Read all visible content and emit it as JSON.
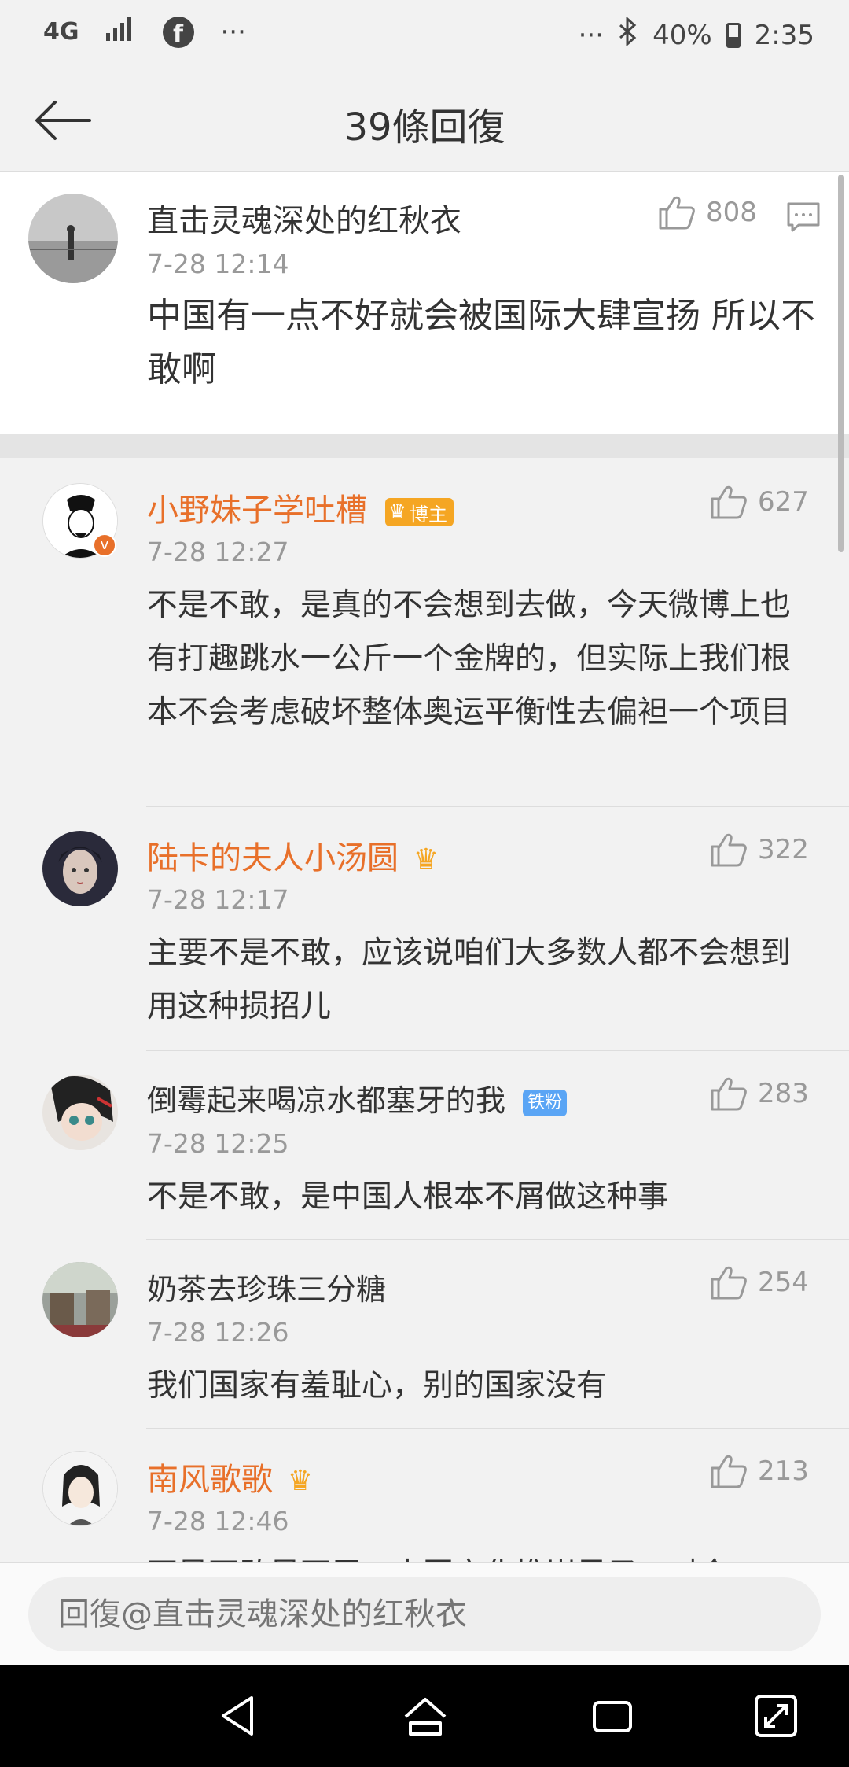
{
  "status_bar": {
    "network": "4G",
    "more": "···",
    "more_right": "···",
    "battery": "40%",
    "time": "2:35"
  },
  "header": {
    "title": "39條回復"
  },
  "post": {
    "user": "直击灵魂深处的红秋衣",
    "time": "7-28 12:14",
    "likes": "808",
    "text": "中国有一点不好就会被国际大肆宣扬 所以不敢啊"
  },
  "replies": [
    {
      "user": "小野妹子学吐槽",
      "badge": "博主",
      "time": "7-28 12:27",
      "likes": "627",
      "text": "不是不敢，是真的不会想到去做，今天微博上也有打趣跳水一公斤一个金牌的，但实际上我们根本不会考虑破坏整体奥运平衡性去偏袒一个项目"
    },
    {
      "user": "陆卡的夫人小汤圆",
      "time": "7-28 12:17",
      "likes": "322",
      "text": "主要不是不敢，应该说咱们大多数人都不会想到用这种损招儿"
    },
    {
      "user": "倒霉起来喝凉水都塞牙的我",
      "badge": "铁粉",
      "time": "7-28 12:25",
      "likes": "283",
      "text": "不是不敢，是中国人根本不屑做这种事"
    },
    {
      "user": "奶茶去珍珠三分糖",
      "time": "7-28 12:26",
      "likes": "254",
      "text": "我们国家有羞耻心，别的国家没有"
    },
    {
      "user": "南风歌歌",
      "time": "7-28 12:46",
      "likes": "213",
      "text": "不是不敢是不屑，中国文化推崇君子，对今"
    }
  ],
  "input": {
    "placeholder": "回復@直击灵魂深处的红秋衣"
  },
  "colors": {
    "orange_name": "#e8702a",
    "background": "#f2f2f2"
  }
}
